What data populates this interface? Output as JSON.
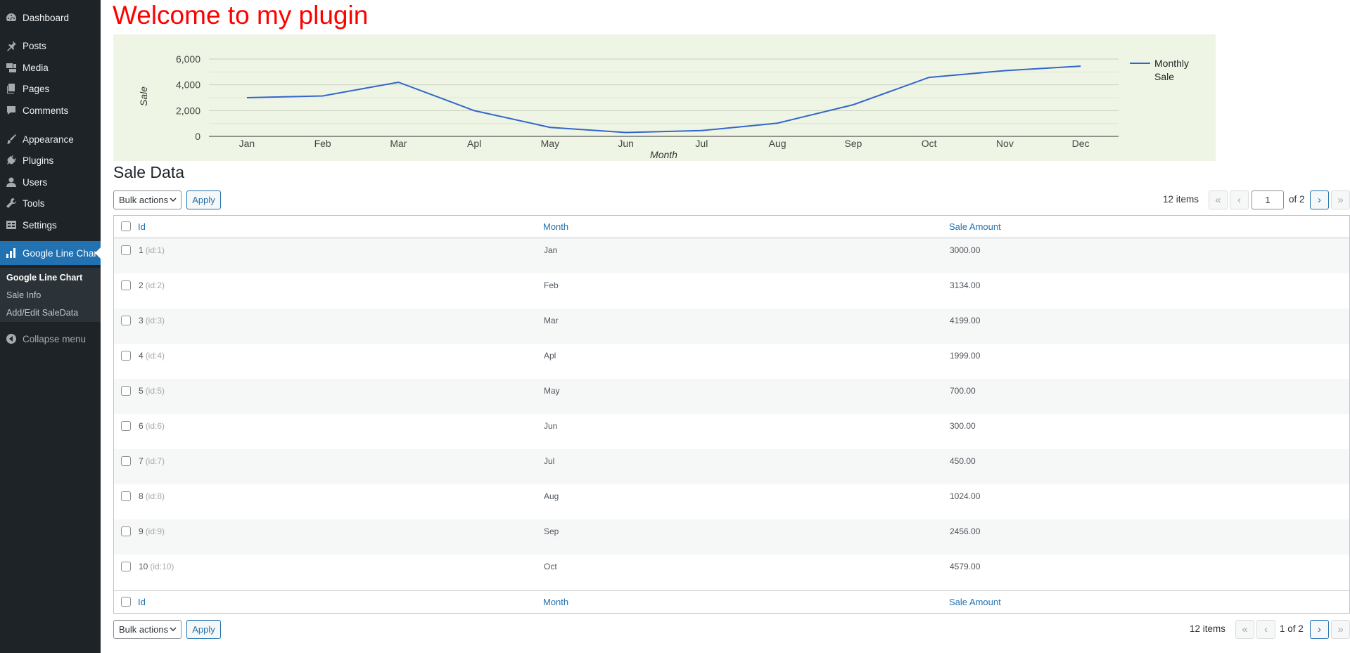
{
  "sidebar": {
    "items": [
      {
        "label": "Dashboard",
        "icon": "dashboard-icon"
      },
      {
        "label": "Posts",
        "icon": "pushpin-icon"
      },
      {
        "label": "Media",
        "icon": "media-icon"
      },
      {
        "label": "Pages",
        "icon": "pages-icon"
      },
      {
        "label": "Comments",
        "icon": "comment-icon"
      },
      {
        "label": "Appearance",
        "icon": "paintbrush-icon"
      },
      {
        "label": "Plugins",
        "icon": "plugin-icon"
      },
      {
        "label": "Users",
        "icon": "user-icon"
      },
      {
        "label": "Tools",
        "icon": "wrench-icon"
      },
      {
        "label": "Settings",
        "icon": "settings-icon"
      },
      {
        "label": "Google Line Chart",
        "icon": "bar-chart-icon"
      }
    ],
    "submenu": [
      "Google Line Chart",
      "Sale Info",
      "Add/Edit SaleData"
    ],
    "collapse_label": "Collapse menu"
  },
  "page_title": "Welcome to my plugin",
  "section_title": "Sale Data",
  "chart_data": {
    "type": "line",
    "categories": [
      "Jan",
      "Feb",
      "Mar",
      "Apl",
      "May",
      "Jun",
      "Jul",
      "Aug",
      "Sep",
      "Oct",
      "Nov",
      "Dec"
    ],
    "series": [
      {
        "name": "Monthly Sale",
        "values": [
          3000,
          3134,
          4199,
          1999,
          700,
          300,
          450,
          1024,
          2456,
          4579,
          5100,
          5450
        ],
        "color": "#3366cc"
      }
    ],
    "legend_lines": [
      "Monthly",
      "Sale"
    ],
    "xlabel": "Month",
    "ylabel": "Sale",
    "ylim": [
      0,
      6000
    ],
    "yticks": [
      "6,000",
      "4,000",
      "2,000",
      "0"
    ],
    "grid": true,
    "legend_position": "right",
    "background": "#eff5e5"
  },
  "toolbar": {
    "bulk_label": "Bulk actions",
    "apply_label": "Apply",
    "items_count": "12 items",
    "first": "«",
    "prev": "‹",
    "next": "›",
    "last": "»",
    "current_page": "1",
    "of_pages": "of 2",
    "page_status": "1 of 2"
  },
  "table": {
    "columns": [
      "Id",
      "Month",
      "Sale Amount"
    ],
    "rows": [
      {
        "id": "1",
        "hint": "(id:1)",
        "month": "Jan",
        "amount": "3000.00"
      },
      {
        "id": "2",
        "hint": "(id:2)",
        "month": "Feb",
        "amount": "3134.00"
      },
      {
        "id": "3",
        "hint": "(id:3)",
        "month": "Mar",
        "amount": "4199.00"
      },
      {
        "id": "4",
        "hint": "(id:4)",
        "month": "Apl",
        "amount": "1999.00"
      },
      {
        "id": "5",
        "hint": "(id:5)",
        "month": "May",
        "amount": "700.00"
      },
      {
        "id": "6",
        "hint": "(id:6)",
        "month": "Jun",
        "amount": "300.00"
      },
      {
        "id": "7",
        "hint": "(id:7)",
        "month": "Jul",
        "amount": "450.00"
      },
      {
        "id": "8",
        "hint": "(id:8)",
        "month": "Aug",
        "amount": "1024.00"
      },
      {
        "id": "9",
        "hint": "(id:9)",
        "month": "Sep",
        "amount": "2456.00"
      },
      {
        "id": "10",
        "hint": "(id:10)",
        "month": "Oct",
        "amount": "4579.00"
      }
    ]
  },
  "colors": {
    "sidebar_bg": "#1d2327",
    "accent": "#2271b1",
    "title_red": "#ff0000"
  }
}
